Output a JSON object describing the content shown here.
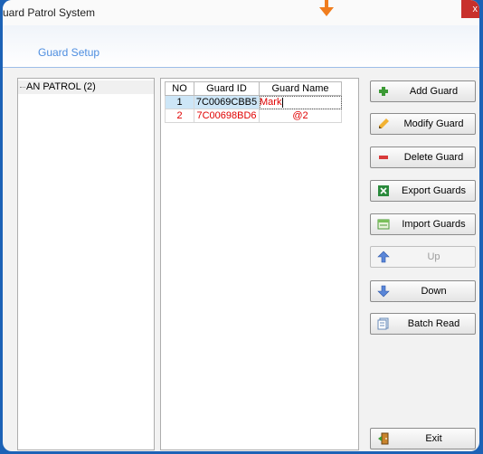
{
  "window": {
    "title": "uard Patrol System",
    "close_glyph": "x"
  },
  "header": {
    "section_title": "Guard Setup"
  },
  "tree": {
    "root_label": "AN PATROL (2)"
  },
  "grid": {
    "columns": [
      "NO",
      "Guard ID",
      "Guard Name"
    ],
    "rows": [
      {
        "no": "1",
        "id": "7C0069CBB5",
        "name": "Mark",
        "selected": true
      },
      {
        "no": "2",
        "id": "7C00698BD6",
        "name": "@2",
        "selected": false
      }
    ]
  },
  "buttons": [
    {
      "label": "Add Guard",
      "icon": "plus-icon",
      "enabled": true
    },
    {
      "label": "Modify Guard",
      "icon": "pencil-icon",
      "enabled": true
    },
    {
      "label": "Delete Guard",
      "icon": "minus-icon",
      "enabled": true
    },
    {
      "label": "Export Guards",
      "icon": "excel-icon",
      "enabled": true
    },
    {
      "label": "Import Guards",
      "icon": "import-icon",
      "enabled": true
    },
    {
      "label": "Up",
      "icon": "up-arrow-icon",
      "enabled": false
    },
    {
      "label": "Down",
      "icon": "down-arrow-icon",
      "enabled": true
    },
    {
      "label": "Batch Read",
      "icon": "batch-read-icon",
      "enabled": true
    },
    {
      "label": "Exit",
      "icon": "exit-door-icon",
      "enabled": true
    }
  ],
  "colors": {
    "accent": "#4e8ee0",
    "desktop": "#1c62b6",
    "highlight_arrow": "#f07d1e",
    "close": "#c8302c",
    "grid_text": "#e00000",
    "selection": "#cde6f7"
  }
}
